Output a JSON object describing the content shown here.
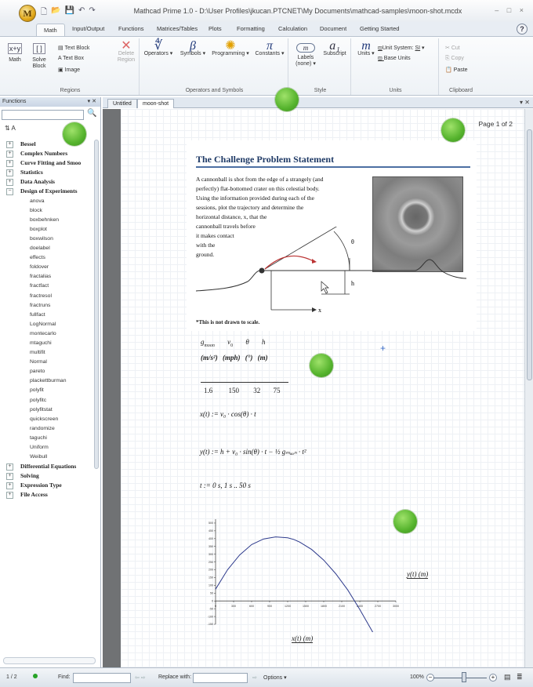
{
  "app": {
    "title": "Mathcad Prime 1.0 - D:\\User Profiles\\jkucan.PTCNET\\My Documents\\mathcad-samples\\moon-shot.mcdx",
    "logo_letter": "M",
    "window_controls": "– □ ×"
  },
  "ribbon_tabs": [
    "Math",
    "Input/Output",
    "Functions",
    "Matrices/Tables",
    "Plots",
    "Formatting",
    "Calculation",
    "Document",
    "Getting Started"
  ],
  "help_label": "?",
  "ribbon": {
    "regions": {
      "label": "Regions",
      "math": "Math",
      "solve_block": "Solve\nBlock",
      "text_block": "Text Block",
      "text_box": "Text Box",
      "image": "Image",
      "delete_region": "Delete\nRegion"
    },
    "operators": {
      "label": "Operators and Symbols",
      "operators": "Operators",
      "symbols": "Symbols",
      "programming": "Programming",
      "constants": "Constants"
    },
    "style": {
      "label": "Style",
      "labels": "Labels",
      "labels_value": "(none)",
      "subscript": "Subscript"
    },
    "units": {
      "label": "Units",
      "units": "Units",
      "unit_system": "Unit System:",
      "unit_system_value": "SI",
      "base_units": "Base Units"
    },
    "clipboard": {
      "label": "Clipboard",
      "cut": "Cut",
      "copy": "Copy",
      "paste": "Paste"
    }
  },
  "sidebar": {
    "title": "Functions",
    "items": [
      {
        "kind": "cat",
        "sign": "+",
        "label": "Bessel"
      },
      {
        "kind": "cat",
        "sign": "+",
        "label": "Complex Numbers"
      },
      {
        "kind": "cat",
        "sign": "+",
        "label": "Curve Fitting and Smoo"
      },
      {
        "kind": "cat",
        "sign": "+",
        "label": "Statistics"
      },
      {
        "kind": "cat",
        "sign": "+",
        "label": "Data Analysis"
      },
      {
        "kind": "cat",
        "sign": "−",
        "label": "Design of Experiments"
      },
      {
        "kind": "fn",
        "label": "anova"
      },
      {
        "kind": "fn",
        "label": "block"
      },
      {
        "kind": "fn",
        "label": "boxbehnken"
      },
      {
        "kind": "fn",
        "label": "boxplot"
      },
      {
        "kind": "fn",
        "label": "boxwilson"
      },
      {
        "kind": "fn",
        "label": "doelabel"
      },
      {
        "kind": "fn",
        "label": "effects"
      },
      {
        "kind": "fn",
        "label": "foldover"
      },
      {
        "kind": "fn",
        "label": "fractalias"
      },
      {
        "kind": "fn",
        "label": "fractfact"
      },
      {
        "kind": "fn",
        "label": "fractresol"
      },
      {
        "kind": "fn",
        "label": "fractruns"
      },
      {
        "kind": "fn",
        "label": "fullfact"
      },
      {
        "kind": "fn",
        "label": "LogNormal"
      },
      {
        "kind": "fn",
        "label": "montecarlo"
      },
      {
        "kind": "fn",
        "label": "mtaguchi"
      },
      {
        "kind": "fn",
        "label": "multifit"
      },
      {
        "kind": "fn",
        "label": "Normal"
      },
      {
        "kind": "fn",
        "label": "pareto"
      },
      {
        "kind": "fn",
        "label": "plackettburman"
      },
      {
        "kind": "fn",
        "label": "polyfit"
      },
      {
        "kind": "fn",
        "label": "polyfitc"
      },
      {
        "kind": "fn",
        "label": "polyfitstat"
      },
      {
        "kind": "fn",
        "label": "quickscreen"
      },
      {
        "kind": "fn",
        "label": "randomize"
      },
      {
        "kind": "fn",
        "label": "taguchi"
      },
      {
        "kind": "fn",
        "label": "Uniform"
      },
      {
        "kind": "fn",
        "label": "Weibull"
      },
      {
        "kind": "cat",
        "sign": "+",
        "label": "Differential Equations"
      },
      {
        "kind": "cat",
        "sign": "+",
        "label": "Solving"
      },
      {
        "kind": "cat",
        "sign": "+",
        "label": "Expression Type"
      },
      {
        "kind": "cat",
        "sign": "+",
        "label": "File Access"
      }
    ]
  },
  "document_tabs": [
    "Untitled",
    "moon-shot"
  ],
  "page": {
    "page_indicator": "Page 1 of 2",
    "heading": "The Challenge Problem Statement",
    "problem_lines": [
      "A cannonball is shot from the edge of a strangely (and",
      "perfectly) flat-bottomed crater on this celestial body.",
      "Using the information provided during each of the",
      "sessions, plot the trajectory and determine the",
      "horizontal distance, x, that the",
      "cannonball travels before",
      "it makes contact",
      "with the",
      "ground."
    ],
    "diagram_labels": {
      "theta": "θ",
      "h": "h",
      "x": "x"
    },
    "note": "*This is not drawn to scale.",
    "table": {
      "headers": [
        "g",
        "v",
        "θ",
        "h"
      ],
      "header_subs": [
        "moon",
        "0",
        "",
        ""
      ],
      "units": [
        "m/s²",
        "mph",
        "°",
        "m"
      ],
      "values": [
        "1.6",
        "150",
        "32",
        "75"
      ]
    },
    "eq_x": "x(t) := v₀ · cos(θ) · t",
    "eq_y": "y(t) := h + v₀ · sin(θ) · t − ½ gₘₒₒₙ · t²",
    "eq_range": "t := 0 s, 1 s .. 50 s",
    "plot_ylabel": "y(t)  (m)",
    "plot_xlabel": "x(t)  (m)"
  },
  "chart_data": {
    "type": "line",
    "xlabel": "x(t) (m)",
    "ylabel": "y(t) (m)",
    "xlim": [
      0,
      3000
    ],
    "ylim": [
      -150,
      525
    ],
    "xticks": [
      0,
      300,
      600,
      900,
      1200,
      1500,
      1800,
      2100,
      2400,
      2700,
      3000
    ],
    "yticks": [
      -150,
      -100,
      -50,
      0,
      50,
      100,
      150,
      200,
      250,
      300,
      350,
      400,
      450,
      500
    ],
    "series": [
      {
        "x": [
          0,
          200,
          400,
          600,
          800,
          1000,
          1200,
          1300,
          1400,
          1600,
          1800,
          2000,
          2200,
          2400,
          2600,
          2800
        ],
        "y": [
          75,
          200,
          295,
          362,
          398,
          411,
          405,
          395,
          378,
          330,
          262,
          175,
          70,
          -55,
          -190,
          -330
        ]
      }
    ],
    "grid": false
  },
  "status": {
    "page_count": "1 / 2",
    "find_label": "Find:",
    "replace_label": "Replace with:",
    "options_label": "Options",
    "zoom": "100%"
  }
}
